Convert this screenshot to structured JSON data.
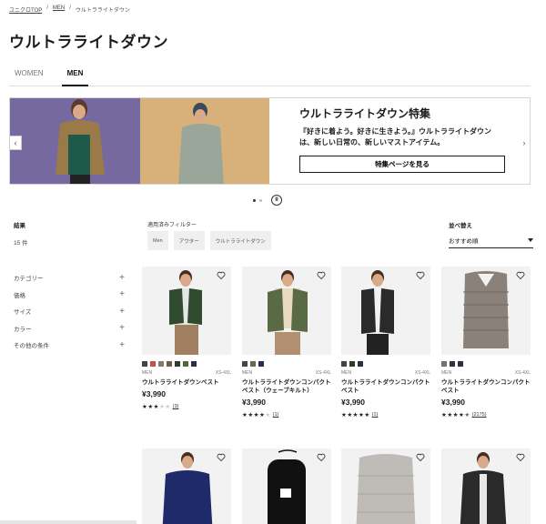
{
  "breadcrumb": {
    "home": "ユニクロTOP",
    "section": "MEN",
    "current": "ウルトラライトダウン",
    "sep": "/"
  },
  "page_title": "ウルトラライトダウン",
  "tabs": [
    {
      "label": "WOMEN",
      "active": false
    },
    {
      "label": "MEN",
      "active": true
    }
  ],
  "banner": {
    "heading": "ウルトラライトダウン特集",
    "text": "『好きに着よう。好きに生きよう。』ウルトラライトダウンは、新しい日常の、新しいマストアイテム。",
    "button": "特集ページを見る",
    "prev_icon": "‹",
    "next_icon": "›",
    "pause_icon": "II"
  },
  "results": {
    "label": "結果",
    "count": "15 件"
  },
  "facets": [
    {
      "label": "カテゴリー",
      "icon": "+"
    },
    {
      "label": "価格",
      "icon": "+"
    },
    {
      "label": "サイズ",
      "icon": "+"
    },
    {
      "label": "カラー",
      "icon": "+"
    },
    {
      "label": "その他の条件",
      "icon": "+"
    }
  ],
  "applied_filters": {
    "label": "適用済みフィルター",
    "chips": [
      "Men",
      "アウター",
      "ウルトラライトダウン"
    ]
  },
  "sort": {
    "label": "並べ替え",
    "value": "おすすめ順"
  },
  "products": [
    {
      "gender": "MEN",
      "sizes": "XS-4XL",
      "name": "ウルトラライトダウンベスト",
      "price": "¥3,990",
      "rating": 3,
      "reviews": "(3)",
      "colors": [
        "#444",
        "#c0534a",
        "#8a7a6a",
        "#6b5f4a",
        "#2f3a2e",
        "#4a6a3a",
        "#2a2f48"
      ]
    },
    {
      "gender": "MEN",
      "sizes": "XS-4XL",
      "name": "ウルトラライトダウンコンパクトベスト（ウェーブキルト）",
      "price": "¥3,990",
      "rating": 4,
      "reviews": "(1)",
      "colors": [
        "#444",
        "#6a6a4a",
        "#2a2f48"
      ]
    },
    {
      "gender": "MEN",
      "sizes": "XS-4XL",
      "name": "ウルトラライトダウンコンパクトベスト",
      "price": "¥3,990",
      "rating": 5,
      "reviews": "(1)",
      "colors": [
        "#444",
        "#2f3a2e",
        "#2a2f48"
      ]
    },
    {
      "gender": "MEN",
      "sizes": "XS-4XL",
      "name": "ウルトラライトダウンコンパクトベスト",
      "price": "¥3,990",
      "rating": 4.5,
      "reviews": "(2175)",
      "colors": [
        "#7a706a",
        "#333",
        "#2a2f48"
      ]
    }
  ]
}
